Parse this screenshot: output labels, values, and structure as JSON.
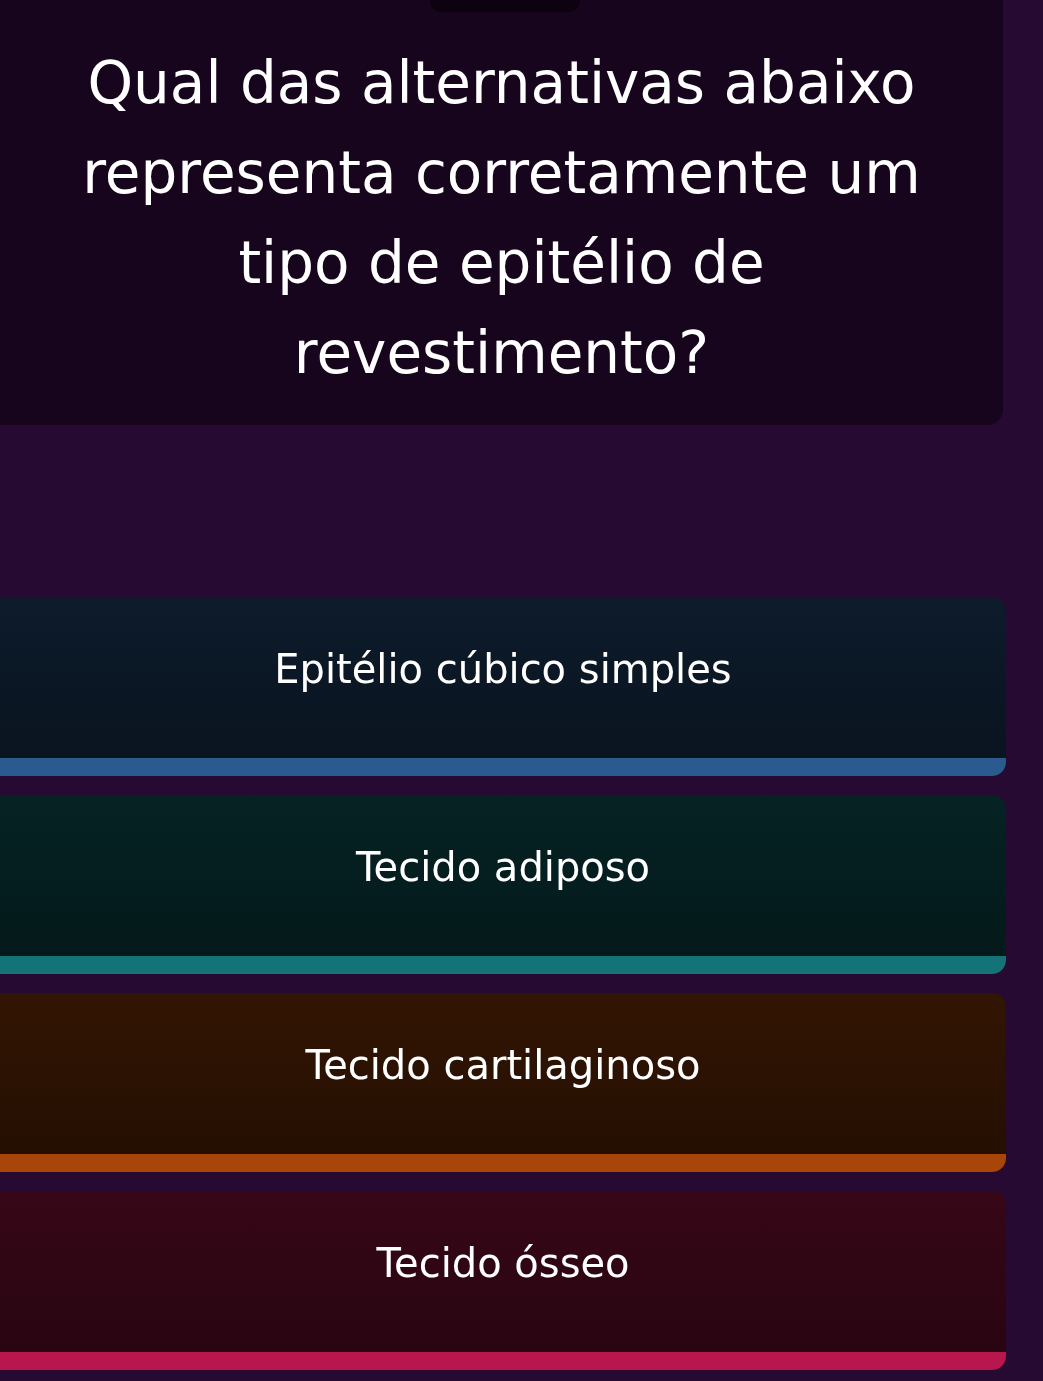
{
  "question": {
    "text": "Qual das alternativas abaixo representa corretamente um tipo de epitélio de revestimento?"
  },
  "options": [
    {
      "label": "Epitélio cúbico simples",
      "color": "#2b5a8f"
    },
    {
      "label": "Tecido adiposo",
      "color": "#137377"
    },
    {
      "label": "Tecido cartilaginoso",
      "color": "#a84508"
    },
    {
      "label": "Tecido ósseo",
      "color": "#b8174d"
    }
  ]
}
